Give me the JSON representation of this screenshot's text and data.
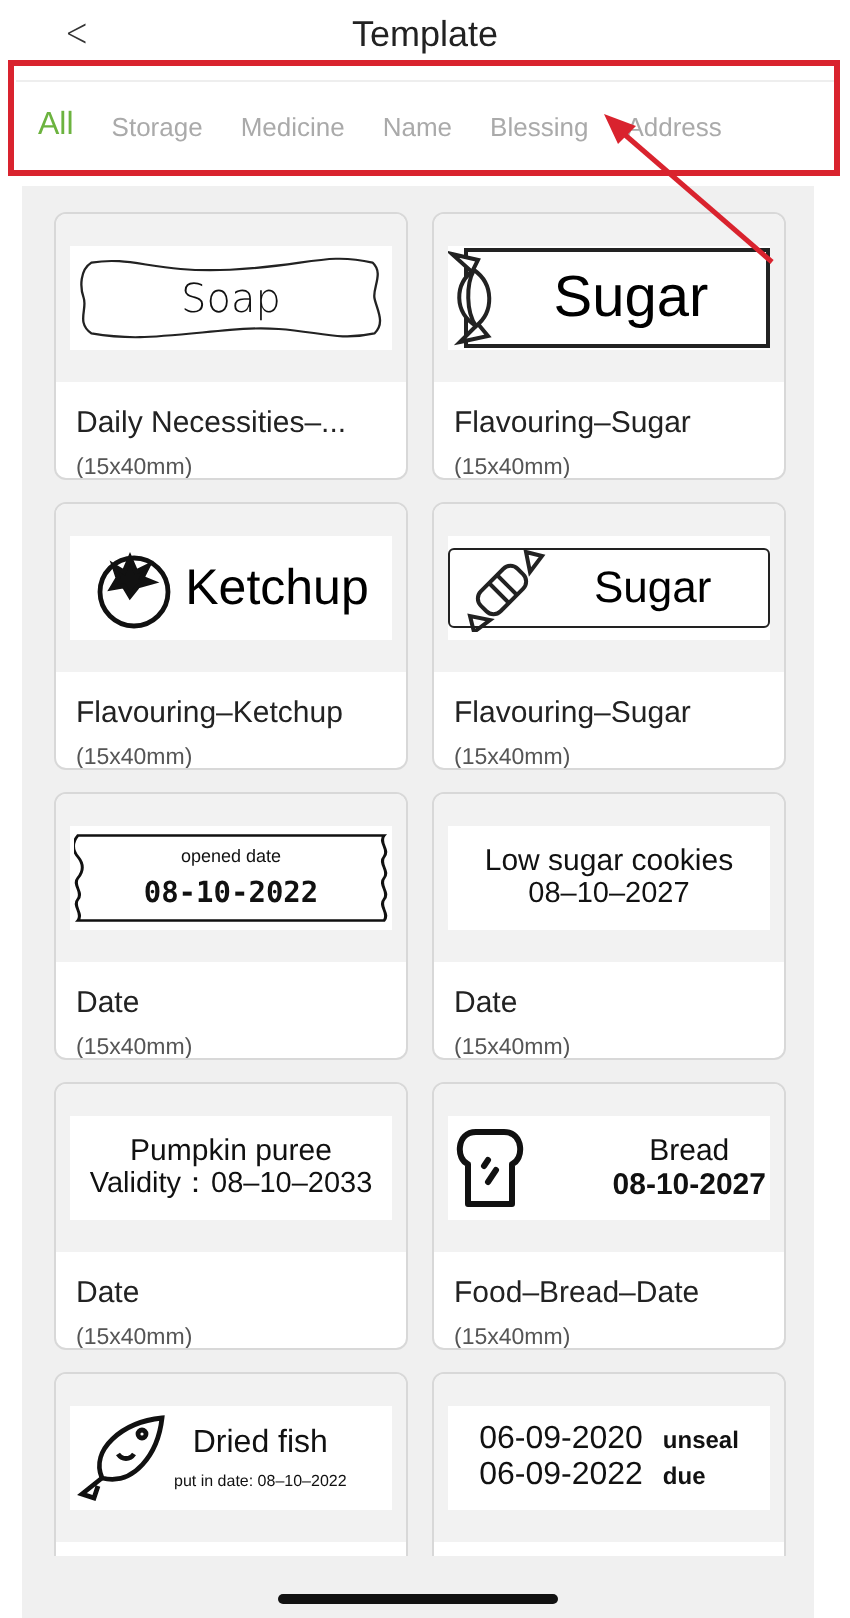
{
  "header": {
    "back": "<",
    "title": "Template"
  },
  "tabs": [
    {
      "label": "All",
      "selected": true
    },
    {
      "label": "Storage",
      "selected": false
    },
    {
      "label": "Medicine",
      "selected": false
    },
    {
      "label": "Name",
      "selected": false
    },
    {
      "label": "Blessing",
      "selected": false
    },
    {
      "label": "Address",
      "selected": false
    }
  ],
  "cards": [
    {
      "title": "Daily Necessities–...",
      "size": "(15x40mm)",
      "label": {
        "kind": "soap",
        "lines": [
          "Soap"
        ]
      }
    },
    {
      "title": "Flavouring–Sugar",
      "size": "(15x40mm)",
      "label": {
        "kind": "candy-box",
        "lines": [
          "Sugar"
        ]
      }
    },
    {
      "title": "Flavouring–Ketchup",
      "size": "(15x40mm)",
      "label": {
        "kind": "tomato",
        "lines": [
          "Ketchup"
        ]
      }
    },
    {
      "title": "Flavouring–Sugar",
      "size": "(15x40mm)",
      "label": {
        "kind": "candy",
        "lines": [
          "Sugar"
        ]
      }
    },
    {
      "title": "Date",
      "size": "(15x40mm)",
      "label": {
        "kind": "ticket",
        "lines": [
          "opened date",
          "08-10-2022"
        ]
      }
    },
    {
      "title": "Date",
      "size": "(15x40mm)",
      "label": {
        "kind": "text",
        "lines": [
          "Low sugar cookies",
          "08–10–2027"
        ]
      }
    },
    {
      "title": "Date",
      "size": "(15x40mm)",
      "label": {
        "kind": "text",
        "lines": [
          "Pumpkin puree",
          "Validity：08–10–2033"
        ]
      }
    },
    {
      "title": "Food–Bread–Date",
      "size": "(15x40mm)",
      "label": {
        "kind": "bread",
        "lines": [
          "Bread",
          "08-10-2027"
        ]
      }
    },
    {
      "label": {
        "kind": "fish",
        "lines": [
          "Dried fish",
          "put in date: 08–10–2022"
        ]
      }
    },
    {
      "label": {
        "kind": "dates",
        "lines": [
          "06-09-2020",
          "unseal",
          "06-09-2022",
          "due"
        ]
      }
    }
  ]
}
